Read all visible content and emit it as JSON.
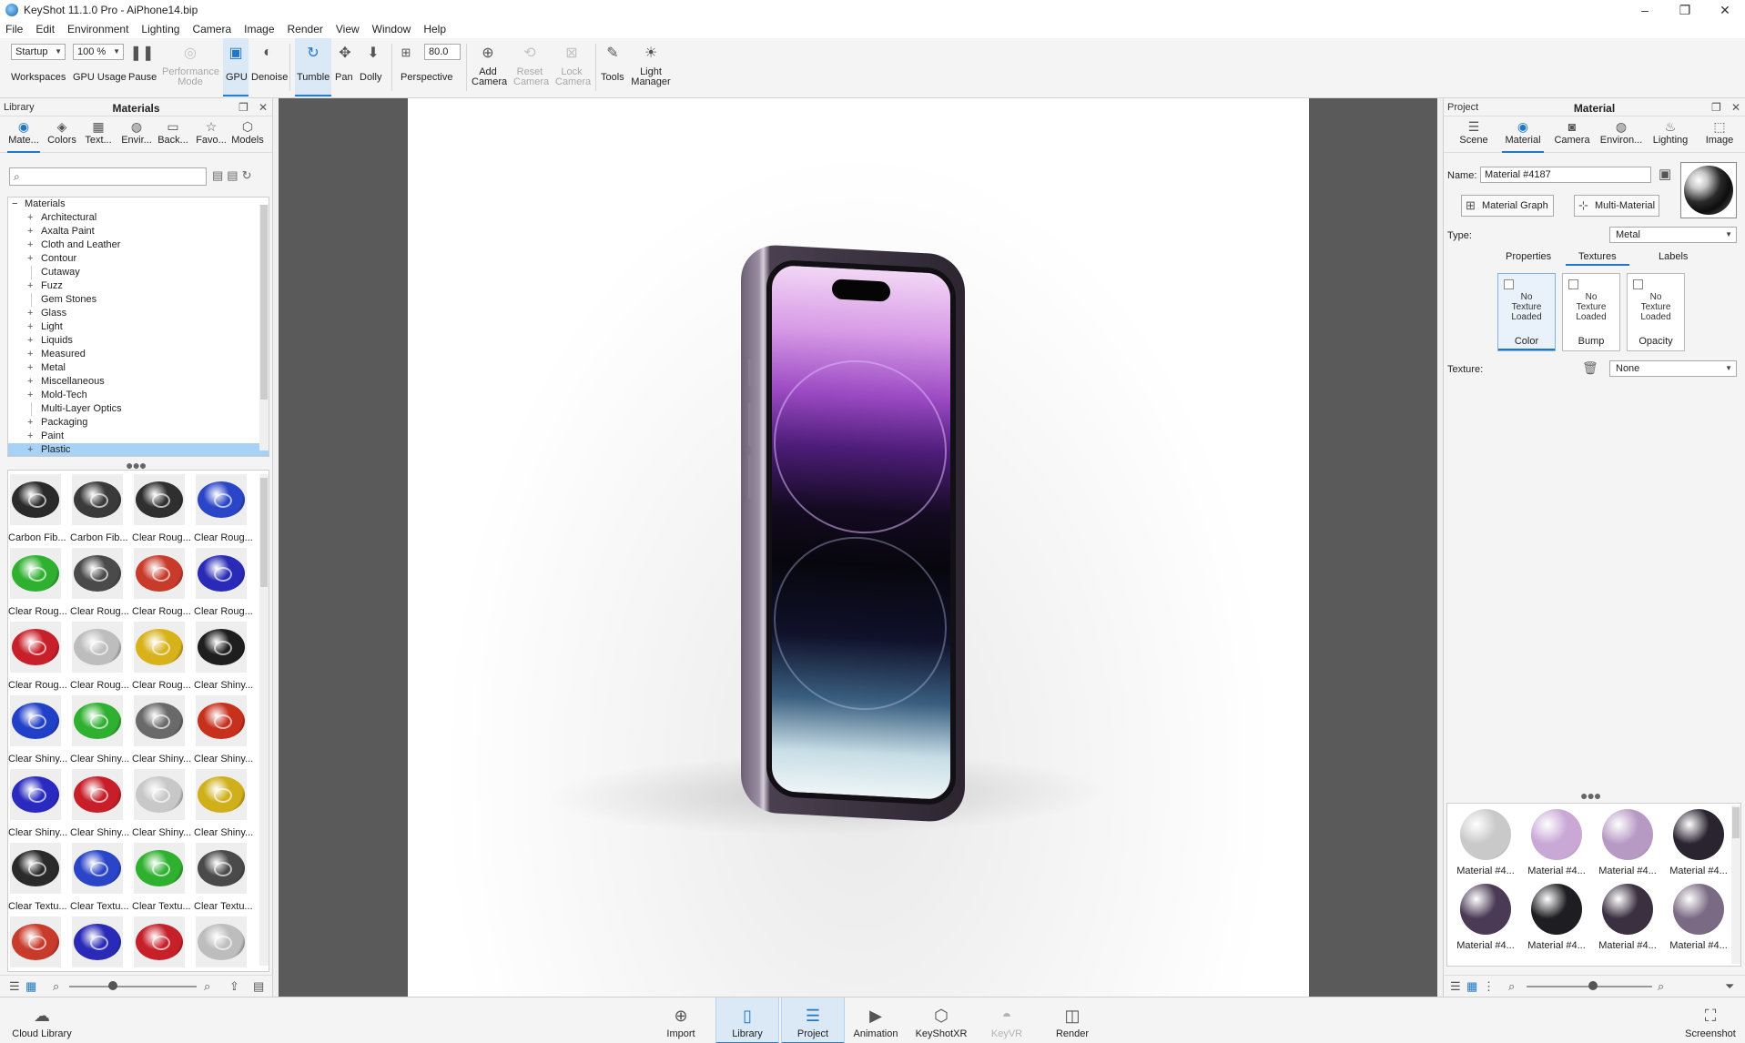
{
  "window": {
    "title": "KeyShot 11.1.0 Pro  - AiPhone14.bip",
    "minimize": "–",
    "maximize": "❐",
    "close": "✕"
  },
  "menu": [
    "File",
    "Edit",
    "Environment",
    "Lighting",
    "Camera",
    "Image",
    "Render",
    "View",
    "Window",
    "Help"
  ],
  "toolbar": {
    "workspace_value": "Startup",
    "workspaces_label": "Workspaces",
    "gpu_usage_value": "100 %",
    "gpu_usage_label": "GPU Usage",
    "pause_label": "Pause",
    "performance_mode_label": "Performance\nMode",
    "gpu_label": "GPU",
    "denoise_label": "Denoise",
    "tumble_label": "Tumble",
    "pan_label": "Pan",
    "dolly_label": "Dolly",
    "fov_value": "80.0",
    "perspective_label": "Perspective",
    "add_camera_label": "Add\nCamera",
    "reset_camera_label": "Reset\nCamera",
    "lock_camera_label": "Lock\nCamera",
    "tools_label": "Tools",
    "light_manager_label": "Light\nManager"
  },
  "library": {
    "header_left": "Library",
    "title": "Materials",
    "tabs": [
      "Mate...",
      "Colors",
      "Text...",
      "Envir...",
      "Back...",
      "Favo...",
      "Models"
    ],
    "search_placeholder": "",
    "tree_root": "Materials",
    "tree_items": [
      {
        "label": "Architectural",
        "expandable": true
      },
      {
        "label": "Axalta Paint",
        "expandable": true
      },
      {
        "label": "Cloth and Leather",
        "expandable": true
      },
      {
        "label": "Contour",
        "expandable": true
      },
      {
        "label": "Cutaway",
        "expandable": false
      },
      {
        "label": "Fuzz",
        "expandable": true
      },
      {
        "label": "Gem Stones",
        "expandable": false
      },
      {
        "label": "Glass",
        "expandable": true
      },
      {
        "label": "Light",
        "expandable": true
      },
      {
        "label": "Liquids",
        "expandable": true
      },
      {
        "label": "Measured",
        "expandable": true
      },
      {
        "label": "Metal",
        "expandable": true
      },
      {
        "label": "Miscellaneous",
        "expandable": true
      },
      {
        "label": "Mold-Tech",
        "expandable": true
      },
      {
        "label": "Multi-Layer Optics",
        "expandable": false
      },
      {
        "label": "Packaging",
        "expandable": true
      },
      {
        "label": "Paint",
        "expandable": true
      },
      {
        "label": "Plastic",
        "expandable": true
      }
    ],
    "selected_item": "Plastic",
    "thumbnails": [
      {
        "label": "Carbon Fib...",
        "color": "#2a2a2a"
      },
      {
        "label": "Carbon Fib...",
        "color": "#3a3a3a"
      },
      {
        "label": "Clear Roug...",
        "color": "#2f2f2f"
      },
      {
        "label": "Clear Roug...",
        "color": "#2a45c8"
      },
      {
        "label": "Clear Roug...",
        "color": "#2fb02f"
      },
      {
        "label": "Clear Roug...",
        "color": "#4a4a4a"
      },
      {
        "label": "Clear Roug...",
        "color": "#c83a2a"
      },
      {
        "label": "Clear Roug...",
        "color": "#2a2ab8"
      },
      {
        "label": "Clear Roug...",
        "color": "#c8202a"
      },
      {
        "label": "Clear Roug...",
        "color": "#bdbdbd"
      },
      {
        "label": "Clear Roug...",
        "color": "#d8b21a"
      },
      {
        "label": "Clear Shiny...",
        "color": "#1e1e1e"
      },
      {
        "label": "Clear Shiny...",
        "color": "#2040c8"
      },
      {
        "label": "Clear Shiny...",
        "color": "#30b030"
      },
      {
        "label": "Clear Shiny...",
        "color": "#6a6a6a"
      },
      {
        "label": "Clear Shiny...",
        "color": "#c8301e"
      },
      {
        "label": "Clear Shiny...",
        "color": "#2a2ac0"
      },
      {
        "label": "Clear Shiny...",
        "color": "#c81e2a"
      },
      {
        "label": "Clear Shiny...",
        "color": "#c8c8c8"
      },
      {
        "label": "Clear Shiny...",
        "color": "#d0b01a"
      },
      {
        "label": "Clear Textu...",
        "color": "#2a2a2a"
      },
      {
        "label": "Clear Textu...",
        "color": "#2a45c8"
      },
      {
        "label": "Clear Textu...",
        "color": "#2fb02f"
      },
      {
        "label": "Clear Textu...",
        "color": "#4a4a4a"
      },
      {
        "label": "",
        "color": "#c83a2a"
      },
      {
        "label": "",
        "color": "#2a2ab8"
      },
      {
        "label": "",
        "color": "#c8202a"
      },
      {
        "label": "",
        "color": "#bdbdbd"
      }
    ]
  },
  "project": {
    "header_left": "Project",
    "title": "Material",
    "tabs": [
      "Scene",
      "Material",
      "Camera",
      "Environ...",
      "Lighting",
      "Image"
    ],
    "name_label": "Name:",
    "name_value": "Material #4187",
    "material_graph_label": "Material Graph",
    "multi_material_label": "Multi-Material",
    "type_label": "Type:",
    "type_value": "Metal",
    "subtabs": [
      "Properties",
      "Textures",
      "Labels"
    ],
    "active_subtab": "Textures",
    "texture_slots": [
      {
        "label": "Color",
        "status": "No\nTexture\nLoaded"
      },
      {
        "label": "Bump",
        "status": "No\nTexture\nLoaded"
      },
      {
        "label": "Opacity",
        "status": "No\nTexture\nLoaded"
      }
    ],
    "texture_label": "Texture:",
    "texture_value": "None",
    "materials": [
      {
        "label": "Material #4...",
        "color": "#c9c9c9"
      },
      {
        "label": "Material #4...",
        "color": "#c9a8d6"
      },
      {
        "label": "Material #4...",
        "color": "#b79ac4"
      },
      {
        "label": "Material #4...",
        "color": "#2a2430"
      },
      {
        "label": "Material #4...",
        "color": "#4a3a55"
      },
      {
        "label": "Material #4...",
        "color": "#1e1e22"
      },
      {
        "label": "Material #4...",
        "color": "#3a3040"
      },
      {
        "label": "Material #4...",
        "color": "#7a6a84"
      }
    ]
  },
  "bottom": {
    "cloud_library": "Cloud Library",
    "import": "Import",
    "library": "Library",
    "project": "Project",
    "animation": "Animation",
    "keyshotxr": "KeyShotXR",
    "keyvr": "KeyVR",
    "render": "Render",
    "screenshot": "Screenshot"
  },
  "colors": {
    "accent": "#1f77c9",
    "selection": "#a8d2f5",
    "viewport_bg": "#5a5a5a"
  }
}
